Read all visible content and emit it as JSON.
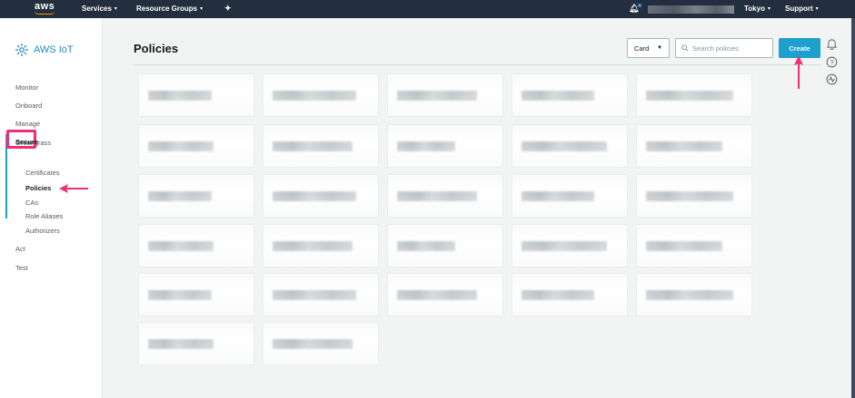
{
  "topnav": {
    "logo": "aws",
    "services_label": "Services",
    "resource_groups_label": "Resource Groups",
    "region_label": "Tokyo",
    "support_label": "Support",
    "colors": {
      "background": "#232f3e",
      "accent": "#ff9900"
    }
  },
  "sidebar": {
    "brand": "AWS IoT",
    "items": [
      {
        "label": "Monitor"
      },
      {
        "label": "Onboard"
      },
      {
        "label": "Manage"
      },
      {
        "label": "Greengrass"
      },
      {
        "label": "Secure"
      },
      {
        "label": "Act"
      },
      {
        "label": "Test"
      }
    ],
    "secure_sub": [
      {
        "label": "Certificates"
      },
      {
        "label": "Policies"
      },
      {
        "label": "CAs"
      },
      {
        "label": "Role Aliases"
      },
      {
        "label": "Authorizers"
      }
    ],
    "active_item": "Policies",
    "colors": {
      "active_bar": "#1ea0cf",
      "annotation": "#ee2d74"
    }
  },
  "main": {
    "title": "Policies",
    "view_select": {
      "value": "Card"
    },
    "search": {
      "placeholder": "Search policies",
      "value": ""
    },
    "create_label": "Create",
    "colors": {
      "primary_button": "#1ea0cf"
    }
  },
  "policies": {
    "card_count": 27
  }
}
